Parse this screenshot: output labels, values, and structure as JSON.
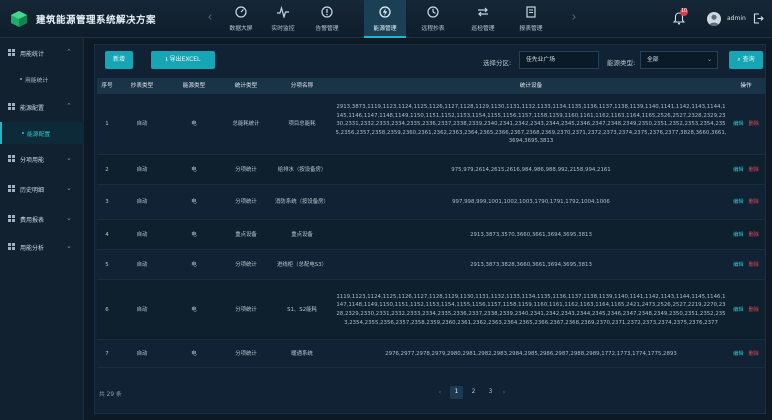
{
  "app": {
    "title": "建筑能源管理系统解决方案"
  },
  "nav": {
    "items": [
      {
        "label": "数据大屏",
        "icon": "dashboard-icon"
      },
      {
        "label": "实时监控",
        "icon": "pulse-icon"
      },
      {
        "label": "告警管理",
        "icon": "alert-icon"
      },
      {
        "label": "能源管理",
        "icon": "energy-icon",
        "active": true
      },
      {
        "label": "远程抄表",
        "icon": "meter-icon"
      },
      {
        "label": "巡检管理",
        "icon": "swap-icon"
      },
      {
        "label": "报表管理",
        "icon": "report-icon"
      }
    ],
    "prev_arrow": "‹",
    "next_arrow": "›"
  },
  "user": {
    "notification_count": "10",
    "name": "admin"
  },
  "sidebar": {
    "groups": [
      {
        "label": "用能统计",
        "expanded": true,
        "children": [
          {
            "label": "用能统计"
          }
        ]
      },
      {
        "label": "能源配置",
        "expanded": true,
        "children": [
          {
            "label": "能源配置",
            "active": true
          }
        ]
      },
      {
        "label": "分项用能"
      },
      {
        "label": "历史明细"
      },
      {
        "label": "费用报表"
      },
      {
        "label": "用能分析"
      }
    ]
  },
  "toolbar": {
    "add_label": "新增",
    "export_label": "导出EXCEL",
    "zone_label": "选择分区:",
    "zone_value": "佳先业广场",
    "energy_type_label": "能源类型:",
    "energy_type_value": "全部",
    "search_label": "查询"
  },
  "table": {
    "headers": [
      "序号",
      "抄表类型",
      "能源类型",
      "统计类型",
      "分项名称",
      "统计设备",
      "操作"
    ],
    "edit_label": "编辑",
    "delete_label": "删除",
    "rows": [
      {
        "no": "1",
        "read_type": "自动",
        "energy": "电",
        "stat_type": "总能耗统计",
        "name": "项目总能耗",
        "devices": "2913,3873,1119,1123,1124,1125,1126,1127,1128,1129,1130,1131,1132,1133,1134,1135,1136,1137,1138,1139,1140,1141,1142,1143,1144,1145,1146,1147,1148,1149,1150,1151,1152,1153,1154,1155,1156,1157,1158,1159,1160,1161,1162,1163,1164,1165,2526,2527,2328,2329,2330,2331,2332,2333,2334,2335,2336,2337,2338,2339,2340,2341,2342,2343,2344,2345,2346,2347,2348,2349,2350,2351,2352,2353,2354,2355,2356,2357,2358,2359,2360,2361,2362,2363,2364,2365,2366,2367,2368,2369,2370,2371,2372,2373,2374,2375,2376,2377,3828,3660,3661,3694,3695,3813"
      },
      {
        "no": "2",
        "read_type": "自动",
        "energy": "电",
        "stat_type": "分项统计",
        "name": "给排水（按设备房）",
        "devices": "975,979,2614,2615,2616,984,986,988,992,2158,994,2161"
      },
      {
        "no": "3",
        "read_type": "自动",
        "energy": "电",
        "stat_type": "分项统计",
        "name": "消防系统（按设备房）",
        "devices": "997,998,999,1001,1002,1003,1790,1791,1792,1004,1006"
      },
      {
        "no": "4",
        "read_type": "自动",
        "energy": "电",
        "stat_type": "重点设备",
        "name": "重点设备",
        "devices": "2913,3873,3570,3660,3661,3694,3695,3813"
      },
      {
        "no": "5",
        "read_type": "自动",
        "energy": "电",
        "stat_type": "分项统计",
        "name": "进线柜（总配电S3）",
        "devices": "2913,3873,3828,3660,3661,3694,3695,3813"
      },
      {
        "no": "6",
        "read_type": "自动",
        "energy": "电",
        "stat_type": "分项统计",
        "name": "S1、S2能耗",
        "devices": "1119,1123,1124,1125,1126,1127,1128,1129,1130,1131,1132,1133,1134,1135,1136,1137,1138,1139,1140,1141,1142,1143,1144,1145,1146,1147,1148,1149,1150,1151,1152,1153,1154,1155,1156,1157,1158,1159,1160,1161,1162,1163,1164,1165,2421,2473,2526,2527,2219,2270,2328,2329,2330,2331,2332,2333,2334,2335,2336,2337,2338,2339,2340,2341,2342,2343,2344,2345,2346,2347,2348,2349,2350,2351,2352,2353,2354,2355,2356,2357,2358,2359,2360,2361,2362,2363,2364,2365,2366,2367,2368,2369,2370,2371,2372,2373,2374,2375,2376,2377"
      },
      {
        "no": "7",
        "read_type": "自动",
        "energy": "电",
        "stat_type": "分项统计",
        "name": "暖通系统",
        "devices": "2976,2977,2978,2979,2980,2981,2982,2983,2984,2985,2986,2987,2988,2989,1772,1773,1774,1775,2893"
      }
    ]
  },
  "pagination": {
    "total_label": "共 29 条",
    "pages": [
      "1",
      "2",
      "3"
    ],
    "active": "1",
    "prev": "‹",
    "next": "›"
  },
  "colors": {
    "accent": "#16a5b5",
    "delete": "#e04a55",
    "background": "#0d1a26"
  }
}
